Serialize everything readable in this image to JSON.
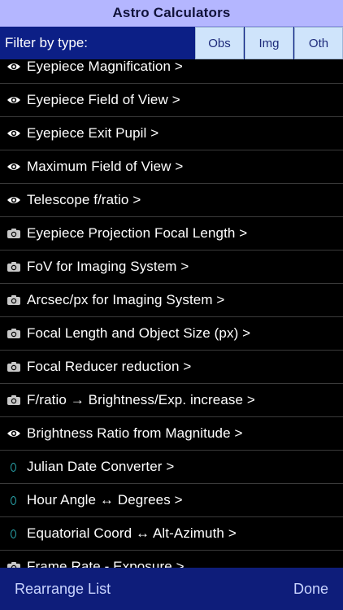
{
  "header": {
    "title": "Astro Calculators"
  },
  "filter": {
    "label": "Filter by type:",
    "buttons": [
      "Obs",
      "Img",
      "Oth"
    ]
  },
  "list": {
    "items": [
      {
        "icon": "eye-icon",
        "label": "Eyepiece Magnification >"
      },
      {
        "icon": "eye-icon",
        "label": "Eyepiece Field of View >"
      },
      {
        "icon": "eye-icon",
        "label": "Eyepiece Exit Pupil >"
      },
      {
        "icon": "eye-icon",
        "label": "Maximum Field of View >"
      },
      {
        "icon": "eye-icon",
        "label": "Telescope f/ratio >"
      },
      {
        "icon": "camera-icon",
        "label": "Eyepiece Projection Focal Length >"
      },
      {
        "icon": "camera-icon",
        "label": "FoV for Imaging System >"
      },
      {
        "icon": "camera-icon",
        "label": "Arcsec/px for Imaging System >"
      },
      {
        "icon": "camera-icon",
        "label": "Focal Length and Object Size (px) >"
      },
      {
        "icon": "camera-icon",
        "label": "Focal Reducer reduction >"
      },
      {
        "icon": "camera-icon",
        "label": "F/ratio → Brightness/Exp. increase >"
      },
      {
        "icon": "eye-icon",
        "label": "Brightness Ratio from Magnitude >"
      },
      {
        "icon": "ring-icon",
        "label": "Julian Date Converter >"
      },
      {
        "icon": "ring-icon",
        "label": "Hour Angle ↔ Degrees >"
      },
      {
        "icon": "ring-icon",
        "label": "Equatorial Coord ↔ Alt-Azimuth >"
      },
      {
        "icon": "camera-icon",
        "label": "Frame Rate - Exposure >"
      }
    ]
  },
  "footer": {
    "rearrange_label": "Rearrange List",
    "done_label": "Done"
  },
  "colors": {
    "header_bg": "#b4b6ff",
    "bar_bg": "#0c1f86",
    "filter_button_bg": "#cfe4fb",
    "ring_icon": "#2aa9b0"
  }
}
